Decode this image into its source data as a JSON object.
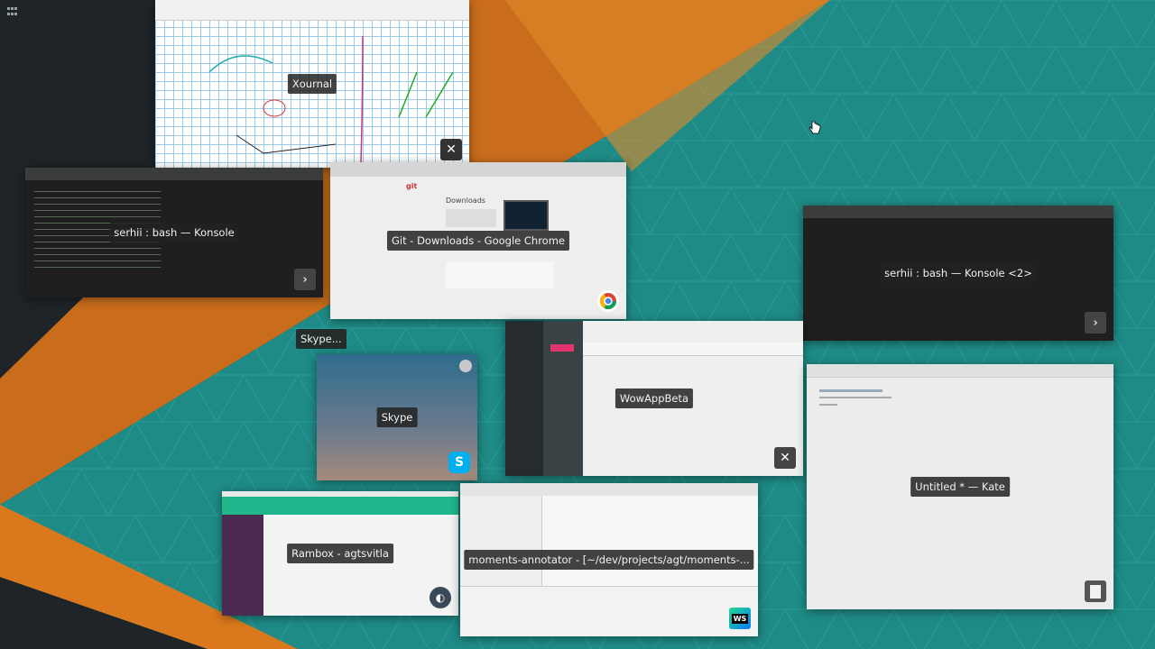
{
  "colors": {
    "teal": "#1e8a86",
    "orange": "#d9781c",
    "dark": "#1f2428",
    "caption_bg": "#222222"
  },
  "windows": {
    "xournal": {
      "title": "Xournal",
      "icon": "xournal-icon"
    },
    "konsole1": {
      "title": "serhii : bash — Konsole",
      "icon": "konsole-icon"
    },
    "chrome": {
      "title": "Git - Downloads - Google Chrome",
      "icon": "chrome-icon",
      "page_heading": "Downloads",
      "site": "git"
    },
    "konsole2": {
      "title": "serhii : bash — Konsole <2>",
      "icon": "konsole-icon"
    },
    "skype_small": {
      "title": "Skype..."
    },
    "skype": {
      "title": "Skype",
      "icon": "skype-icon"
    },
    "wowapp": {
      "title": "WowAppBeta",
      "icon": "x11-icon"
    },
    "kate": {
      "title": "Untitled * — Kate",
      "icon": "kate-icon"
    },
    "rambox": {
      "title": "Rambox - agtsvitla",
      "icon": "rambox-icon"
    },
    "webstorm": {
      "title": "moments-annotator - [~/dev/projects/agt/moments-...",
      "icon": "webstorm-icon"
    }
  }
}
